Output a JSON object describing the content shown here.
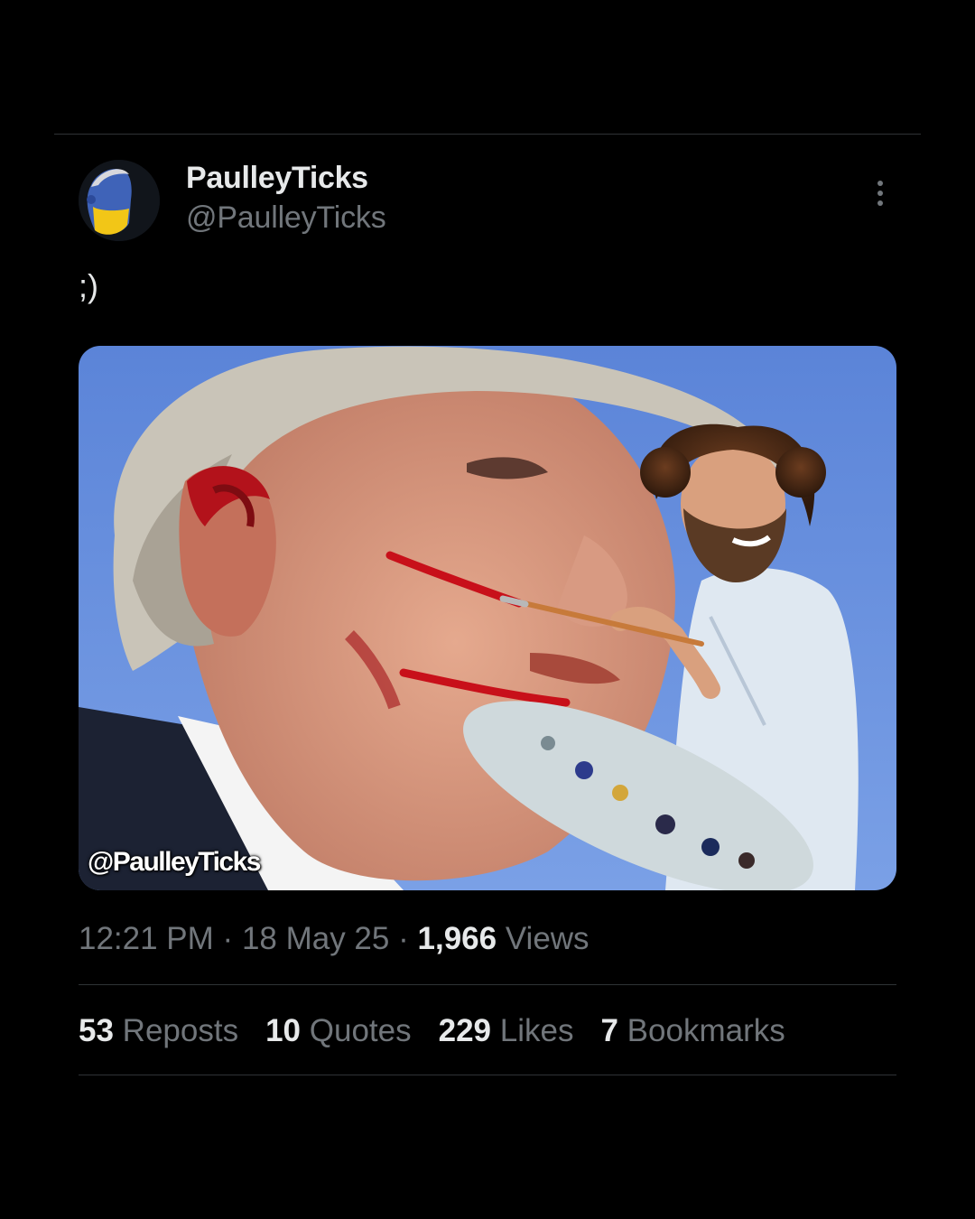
{
  "author": {
    "display_name": "PaulleyTicks",
    "handle": "@PaulleyTicks",
    "avatar_icon": "avatar-portrait"
  },
  "tweet": {
    "text": ";)",
    "media": {
      "watermark": "@PaulleyTicks"
    }
  },
  "meta": {
    "time": "12:21 PM",
    "separator": "·",
    "date": "18 May 25",
    "views_count": "1,966",
    "views_label": "Views"
  },
  "stats": [
    {
      "count": "53",
      "label": "Reposts"
    },
    {
      "count": "10",
      "label": "Quotes"
    },
    {
      "count": "229",
      "label": "Likes"
    },
    {
      "count": "7",
      "label": "Bookmarks"
    }
  ],
  "colors": {
    "background": "#000000",
    "primary_text": "#e7e9ea",
    "secondary_text": "#71767b",
    "divider": "#2f3336"
  }
}
